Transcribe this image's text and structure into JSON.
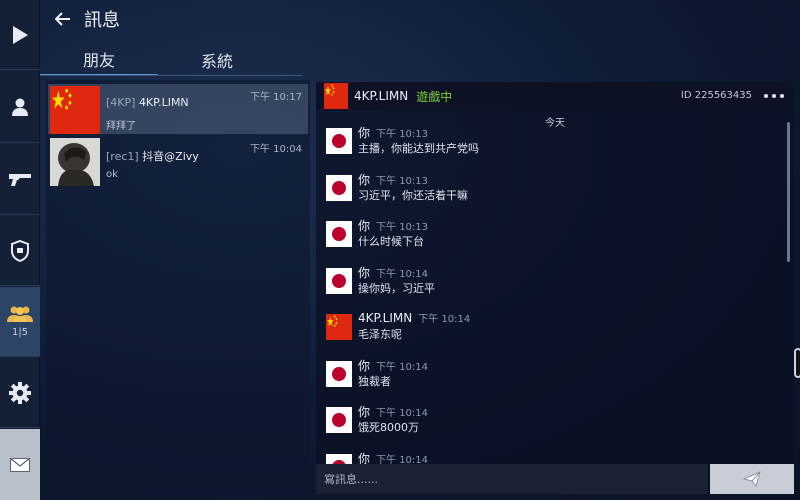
{
  "header": {
    "title": "訊息"
  },
  "rail": {
    "squad_count": "1|5"
  },
  "tabs": [
    {
      "label": "朋友"
    },
    {
      "label": "系統"
    }
  ],
  "contacts": [
    {
      "tag": "[4KP]",
      "name": "4KP.LIMN",
      "time": "下午 10:17",
      "last_message": "拜拜了",
      "avatar": "china-flag"
    },
    {
      "tag": "[rec1]",
      "name": "抖音@Zivy",
      "time": "下午 10:04",
      "last_message": "ok",
      "avatar": "photo"
    }
  ],
  "chat": {
    "name": "4KP.LIMN",
    "status": "遊戲中",
    "id": "ID 225563435",
    "date_separator": "今天",
    "messages": [
      {
        "sender": "你",
        "time": "下午 10:13",
        "text": "主播，你能达到共产党吗",
        "avatar": "japan-flag"
      },
      {
        "sender": "你",
        "time": "下午 10:13",
        "text": "习近平，你还活着干嘛",
        "avatar": "japan-flag"
      },
      {
        "sender": "你",
        "time": "下午 10:13",
        "text": "什么时候下台",
        "avatar": "japan-flag"
      },
      {
        "sender": "你",
        "time": "下午 10:14",
        "text": "操你妈，习近平",
        "avatar": "japan-flag"
      },
      {
        "sender": "4KP.LIMN",
        "time": "下午 10:14",
        "text": "毛泽东呢",
        "avatar": "china-flag"
      },
      {
        "sender": "你",
        "time": "下午 10:14",
        "text": "独裁者",
        "avatar": "japan-flag"
      },
      {
        "sender": "你",
        "time": "下午 10:14",
        "text": "饿死8000万",
        "avatar": "japan-flag"
      },
      {
        "sender": "你",
        "time": "下午 10:14",
        "text": "",
        "avatar": "japan-flag"
      }
    ]
  },
  "input": {
    "placeholder": "寫訊息......"
  },
  "colors": {
    "online": "#7fd03a",
    "accent": "#5c8ed0",
    "china_red": "#de2910",
    "japan_red": "#bc002d"
  }
}
